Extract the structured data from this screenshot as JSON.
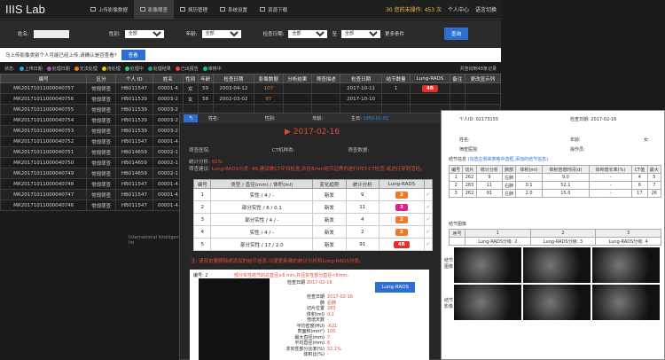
{
  "app": {
    "title": "IIIS Lab",
    "subtitle": "International Intelligent Im"
  },
  "nav": {
    "tabs": [
      {
        "label": "上传影像数据"
      },
      {
        "label": "影像筛查"
      },
      {
        "label": "病历管理"
      },
      {
        "label": "系统设置"
      },
      {
        "label": "资源下载"
      }
    ],
    "pending_label": "30 您的未操作",
    "pending_count": "453",
    "pending_unit": "次",
    "user_center": "个人中心",
    "language": "语言切换"
  },
  "filter": {
    "name_label": "姓名:",
    "sex_label": "性别:",
    "sex_value": "全部",
    "age_label": "年龄:",
    "age_value": "全部",
    "date_label": "检查日期:",
    "date_from": "全部",
    "date_sep": "至",
    "date_to": "全部",
    "more": "更多条件",
    "query": "查询"
  },
  "upload": {
    "text": "马上传影像类别个人可能已经上传,请确认是否查看?",
    "button": "查看"
  },
  "legend": {
    "prefix": "状态:",
    "items": [
      {
        "label": "上传日期",
        "color": "#3a9ad9"
      },
      {
        "label": "处理日期",
        "color": "#9b59b6"
      },
      {
        "label": "无法处理",
        "color": "#e67e22"
      },
      {
        "label": "待处理",
        "color": "#f1c40f"
      },
      {
        "label": "处理中",
        "color": "#2ecc71"
      },
      {
        "label": "处理结果",
        "color": "#16a085"
      },
      {
        "label": "已出报告",
        "color": "#e74c3c"
      },
      {
        "label": "审核中",
        "color": "#1abc9c"
      }
    ],
    "total": "共查询到48条记录"
  },
  "table": {
    "headers": [
      "编号",
      "区分",
      "个人 ID",
      "姓名",
      "性别",
      "年龄",
      "检查日期",
      "影像数据",
      "分析结果",
      "筛查描述",
      "检查日期",
      "结节数量",
      "Lung-RADS",
      "备注",
      "更改显示列"
    ],
    "rows": [
      [
        "MR20171011000040757",
        "常规筛查",
        "HB011547",
        "00001-4",
        "女",
        "59",
        "2003-04-12",
        "107",
        "",
        "",
        "2017-10-11",
        "1",
        "4B",
        "",
        ""
      ],
      [
        "MR20171011000040756",
        "常规筛查",
        "HB011539",
        "00003-2",
        "女",
        "58",
        "2002-03-02",
        "97",
        "",
        "",
        "2017-10-10",
        "",
        "",
        "",
        ""
      ],
      [
        "MR20171011000040755",
        "常规筛查",
        "HB011539",
        "00003-2",
        "",
        "",
        "",
        "",
        "",
        "",
        "",
        "",
        "",
        "",
        ""
      ],
      [
        "MR20171011000040754",
        "常规筛查",
        "HB011539",
        "00003-2",
        "",
        "",
        "",
        "",
        "",
        "",
        "",
        "",
        "",
        "",
        ""
      ],
      [
        "MR20171011000040753",
        "常规筛查",
        "HB011539",
        "00003-2",
        "",
        "",
        "",
        "",
        "",
        "",
        "",
        "",
        "",
        "",
        ""
      ],
      [
        "MR20171011000040752",
        "常规筛查",
        "HB011547",
        "00001-4",
        "",
        "",
        "",
        "",
        "",
        "",
        "",
        "",
        "",
        "",
        ""
      ],
      [
        "MR20171011000040751",
        "常规筛查",
        "HB014659",
        "00002-1",
        "",
        "",
        "",
        "",
        "",
        "",
        "",
        "",
        "",
        "",
        ""
      ],
      [
        "MR20171011000040750",
        "常规筛查",
        "HB014659",
        "00002-1",
        "",
        "",
        "",
        "",
        "",
        "",
        "",
        "",
        "",
        "",
        ""
      ],
      [
        "MR20171011000040749",
        "常规筛查",
        "HB014659",
        "00002-1",
        "",
        "",
        "",
        "",
        "",
        "",
        "",
        "",
        "",
        "",
        ""
      ],
      [
        "MR20171011000040748",
        "常规筛查",
        "HB011547",
        "00001-4",
        "",
        "",
        "",
        "",
        "",
        "",
        "",
        "",
        "",
        "",
        ""
      ],
      [
        "MR20171011000040747",
        "常规筛查",
        "HB011547",
        "00001-4",
        "",
        "",
        "",
        "",
        "",
        "",
        "",
        "",
        "",
        "",
        ""
      ],
      [
        "MR20171011000040746",
        "常规筛查",
        "HB011547",
        "00001-4",
        "",
        "",
        "",
        "",
        "",
        "",
        "",
        "",
        "",
        "",
        ""
      ]
    ]
  },
  "modal1": {
    "back": "↰",
    "name_label": "姓名:",
    "sex_label": "性别:",
    "age_label": "年龄:",
    "birth_label": "生日:",
    "birth_value": "1950-01-01",
    "date_title": "2017-02-16",
    "doctor_label": "筛查医院:",
    "ct_label": "CT机种类:",
    "ct_value": "",
    "check_label": "筛查数据:",
    "stat_label": "统计分析:",
    "stat_value": "91%",
    "desc_label": "筛查建议:",
    "desc_value": "Lung-RADS分类: 4B,建议做CT平扫检查,并在6mm结节边界内进行PET-CT检查,或进行穿刺活检。",
    "table_headers": [
      "编号",
      "类型 / 直径(mm) / 体积(ml)",
      "变化趋势",
      "统计分析",
      "Lung-RADS",
      ""
    ],
    "table_rows": [
      {
        "no": "1",
        "type": "实性 / 4 / -",
        "trend": "新发",
        "stat": "9",
        "rads": "2",
        "color": "#f07a2c"
      },
      {
        "no": "2",
        "type": "部分实性 / 6 / 0.1",
        "trend": "新发",
        "stat": "11",
        "rads": "3",
        "color": "#e0208c"
      },
      {
        "no": "3",
        "type": "部分实性 / 4 / -",
        "trend": "新发",
        "stat": "4",
        "rads": "2",
        "color": "#f07a2c"
      },
      {
        "no": "4",
        "type": "实性 / 4 / -",
        "trend": "新发",
        "stat": "2",
        "rads": "2",
        "color": "#f07a2c"
      },
      {
        "no": "5",
        "type": "部分实性 / 17 / 2.0",
        "trend": "新发",
        "stat": "91",
        "rads": "4B",
        "color": "#e0302c"
      }
    ],
    "note": "注: 请双击要删除或添加的结节信息,以便更新确的统计分析和Lung-RADS分类。",
    "detail_no": "编号: 2",
    "detail_desc": "部分实性结节的总直径≥6 mm,并且实性部分直径<6mm。",
    "detail_date": "2017-02-16",
    "lung_rads_btn": "Lung-RADS",
    "lung_rads_label": "Lung-RADS",
    "stats": [
      {
        "k": "检查日期",
        "v": "2017-02-16"
      },
      {
        "k": "肺",
        "v": "右肺"
      },
      {
        "k": "切片位置",
        "v": "283"
      },
      {
        "k": "体积(ml)",
        "v": "0.1"
      },
      {
        "k": "倍增天数",
        "v": "-"
      },
      {
        "k": "平均密度(HU)",
        "v": "-621"
      },
      {
        "k": "表面积(mm²)",
        "v": "100"
      },
      {
        "k": "最大直径(mm)",
        "v": "7"
      },
      {
        "k": "平均直径(mm)",
        "v": "6"
      },
      {
        "k": "非实性部分比率(%)",
        "v": "52.1%"
      },
      {
        "k": "体积比(%)",
        "v": "-"
      }
    ]
  },
  "modal2": {
    "id_label": "个人ID:",
    "id_value": "02173155",
    "date_label": "检查日期:",
    "date_value": "2017-02-16",
    "name_label": "姓名:",
    "age_label": "年龄:",
    "age_value": "岁",
    "sex_label": "性别:",
    "sex_value": "女",
    "hosp_label": "筛查医院:",
    "doctor_label": "操作员:",
    "section1": "结节信息",
    "section1_note": "(勾选左侧来表格中选框,添加的结节信息)",
    "headers": [
      "编号",
      "切片",
      "统计分析",
      "肺部",
      "体积(ml)",
      "体积倍增时间(d)",
      "体积增长率(%)",
      "CT值",
      "最大"
    ],
    "rows": [
      [
        "1",
        "262",
        "9",
        "左肺",
        "-",
        "9.0",
        "-",
        "4",
        "5"
      ],
      [
        "2",
        "283",
        "11",
        "右肺",
        "0.1",
        "52.1",
        "-",
        "6",
        "7"
      ],
      [
        "3",
        "262",
        "91",
        "左肺",
        "2.0",
        "15.0",
        "-",
        "17",
        "26"
      ]
    ],
    "section2": "结节图像",
    "img_headers": [
      "序号",
      "1",
      "2",
      "3"
    ],
    "img_sub": [
      "Lung-RADS分级: 2",
      "Lung-RADS分级: 3",
      "Lung-RADS分级: 4"
    ],
    "side1": "结节图像",
    "side2": "结节影像"
  }
}
